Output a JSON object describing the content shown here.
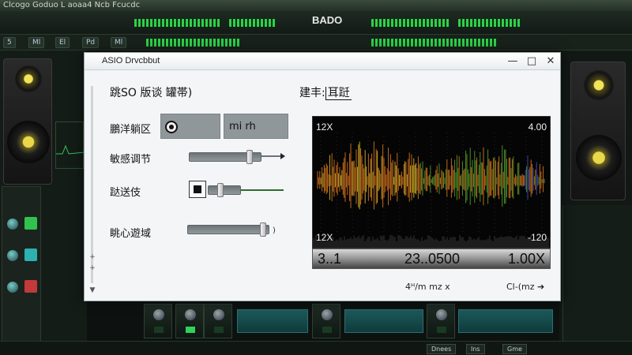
{
  "daw": {
    "window_title": "Clcogo Goduo L aoaa4 Ncb Fcucdc",
    "app_name": "BADO",
    "toolbar_buttons": [
      "5",
      "Ml",
      "El",
      "Pd",
      "Ml"
    ],
    "bottom_buttons": [
      "Dnees",
      "Ins",
      "Gme"
    ]
  },
  "dialog": {
    "title": "ASIO Drvcbbut",
    "heading_left": "跳SO 版谈  罐帯)",
    "heading_right": "建丰:",
    "heading_right_boxed": "耳跹",
    "rows": [
      {
        "label": "鵬洋躺区",
        "field1_icon": "record-icon",
        "field2_value": "mi rh"
      },
      {
        "label": "敏感调节",
        "slider_value": 0.88
      },
      {
        "label": "跶送伎",
        "slider_value": 0.35
      },
      {
        "label": "眺心遊域",
        "slider_value": 0.97
      }
    ],
    "waveform": {
      "top_left": "12X",
      "top_right": "4.00",
      "bottom_left": "12X",
      "bottom_right": "-120"
    },
    "readouts": [
      "3..1",
      "23..0500",
      "1.00X"
    ],
    "footer_left": "4ᵸ/m mz x",
    "footer_right": "Cl-(mz ➔"
  },
  "colors": {
    "wave_orange": "#e07a1e",
    "wave_yellow": "#e6c22a",
    "wave_green": "#5aa32c",
    "wave_blue": "#3b54c8",
    "dialog_bg": "#f3f5f6"
  }
}
